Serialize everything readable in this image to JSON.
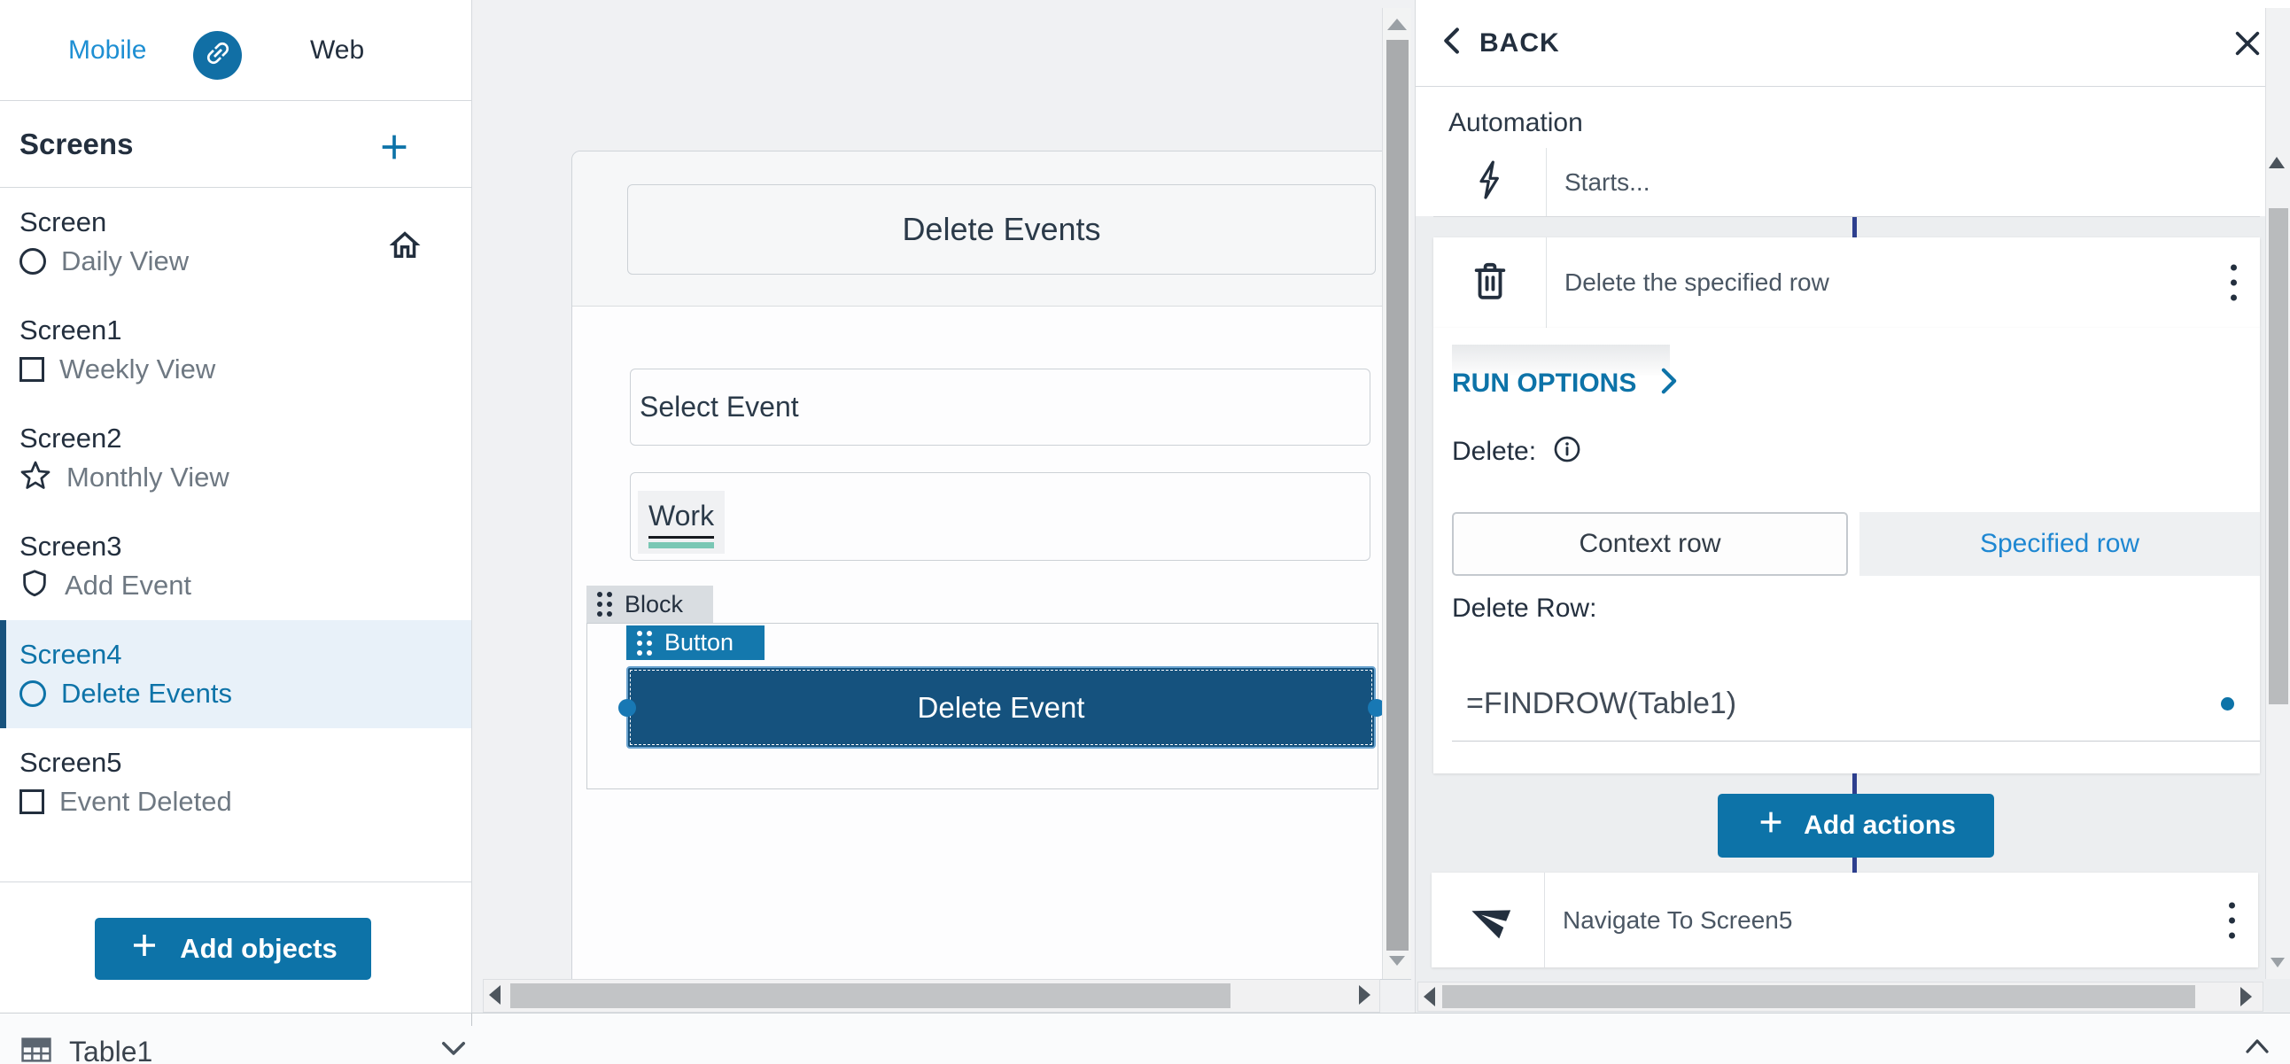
{
  "colors": {
    "accent": "#0d73a8",
    "accent-dark": "#17527d",
    "link-blue": "#1e87d2",
    "tab-blue": "#1e8fd3",
    "navy": "#232f3e",
    "gray-text": "#6e7882",
    "selected-bg": "#e8f1f9",
    "connector": "#2d3f8e",
    "teal": "#79c7b4"
  },
  "tabs": {
    "mobile": "Mobile",
    "web": "Web"
  },
  "sidebar": {
    "screens_header": "Screens",
    "screens": [
      {
        "name": "Screen",
        "label": "Daily View"
      },
      {
        "name": "Screen1",
        "label": "Weekly View"
      },
      {
        "name": "Screen2",
        "label": "Monthly View"
      },
      {
        "name": "Screen3",
        "label": "Add Event"
      },
      {
        "name": "Screen4",
        "label": "Delete Events"
      },
      {
        "name": "Screen5",
        "label": "Event Deleted"
      }
    ],
    "add_objects": "Add objects"
  },
  "canvas": {
    "title": "Delete Events",
    "select_event": "Select Event",
    "work": "Work",
    "block_chip": "Block",
    "button_chip": "Button",
    "delete_button": "Delete Event"
  },
  "panel": {
    "back": "BACK",
    "automation": "Automation",
    "starts": "Starts...",
    "delete_action": "Delete the specified row",
    "run_options": "RUN OPTIONS",
    "delete_label": "Delete:",
    "context_row": "Context row",
    "specified_row": "Specified row",
    "delete_row_label": "Delete Row:",
    "formula": "=FINDROW(Table1)",
    "add_actions": "Add actions",
    "navigate_action": "Navigate To Screen5"
  },
  "footer": {
    "table_name": "Table1"
  }
}
